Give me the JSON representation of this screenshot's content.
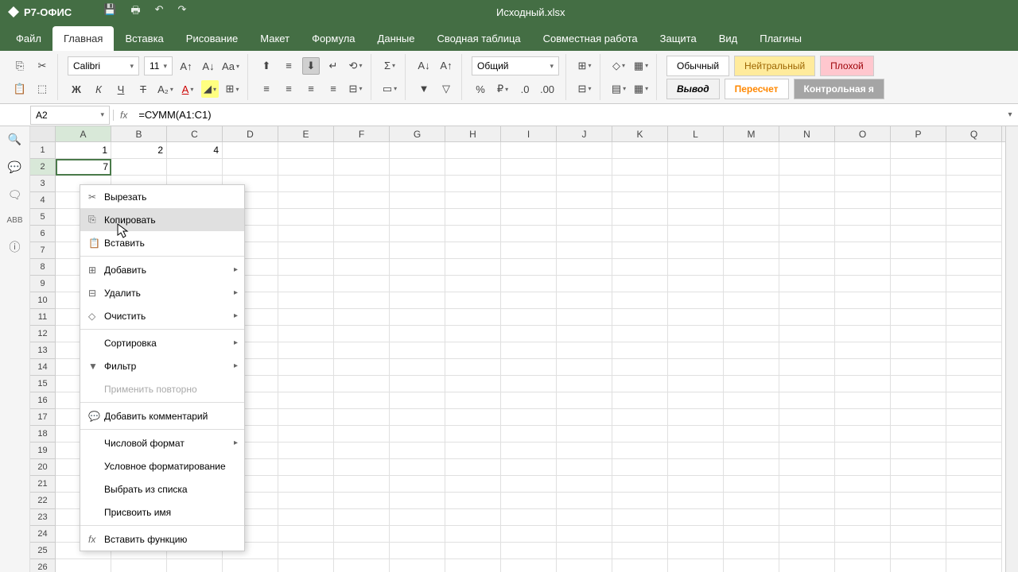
{
  "app_name": "Р7-ОФИС",
  "document_title": "Исходный.xlsx",
  "menu_tabs": [
    "Файл",
    "Главная",
    "Вставка",
    "Рисование",
    "Макет",
    "Формула",
    "Данные",
    "Сводная таблица",
    "Совместная работа",
    "Защита",
    "Вид",
    "Плагины"
  ],
  "active_tab": 1,
  "font_name": "Calibri",
  "font_size": "11",
  "number_format": "Общий",
  "cell_styles": {
    "normal": "Обычный",
    "neutral": "Нейтральный",
    "bad": "Плохой",
    "output": "Вывод",
    "calc": "Пересчет",
    "check": "Контрольная я"
  },
  "name_box": "A2",
  "formula": "=СУММ(A1:C1)",
  "columns": [
    "A",
    "B",
    "C",
    "D",
    "E",
    "F",
    "G",
    "H",
    "I",
    "J",
    "K",
    "L",
    "M",
    "N",
    "O",
    "P",
    "Q"
  ],
  "row_count": 26,
  "cell_data": {
    "r1": {
      "A": "1",
      "B": "2",
      "C": "4"
    },
    "r2": {
      "A": "7"
    }
  },
  "selected_cell": {
    "row": 2,
    "col": "A"
  },
  "context_menu": {
    "cut": "Вырезать",
    "copy": "Копировать",
    "paste": "Вставить",
    "add": "Добавить",
    "delete": "Удалить",
    "clear": "Очистить",
    "sort": "Сортировка",
    "filter": "Фильтр",
    "reapply": "Применить повторно",
    "comment": "Добавить комментарий",
    "numfmt": "Числовой формат",
    "condfmt": "Условное форматирование",
    "pick": "Выбрать из списка",
    "name": "Присвоить имя",
    "func": "Вставить функцию"
  }
}
